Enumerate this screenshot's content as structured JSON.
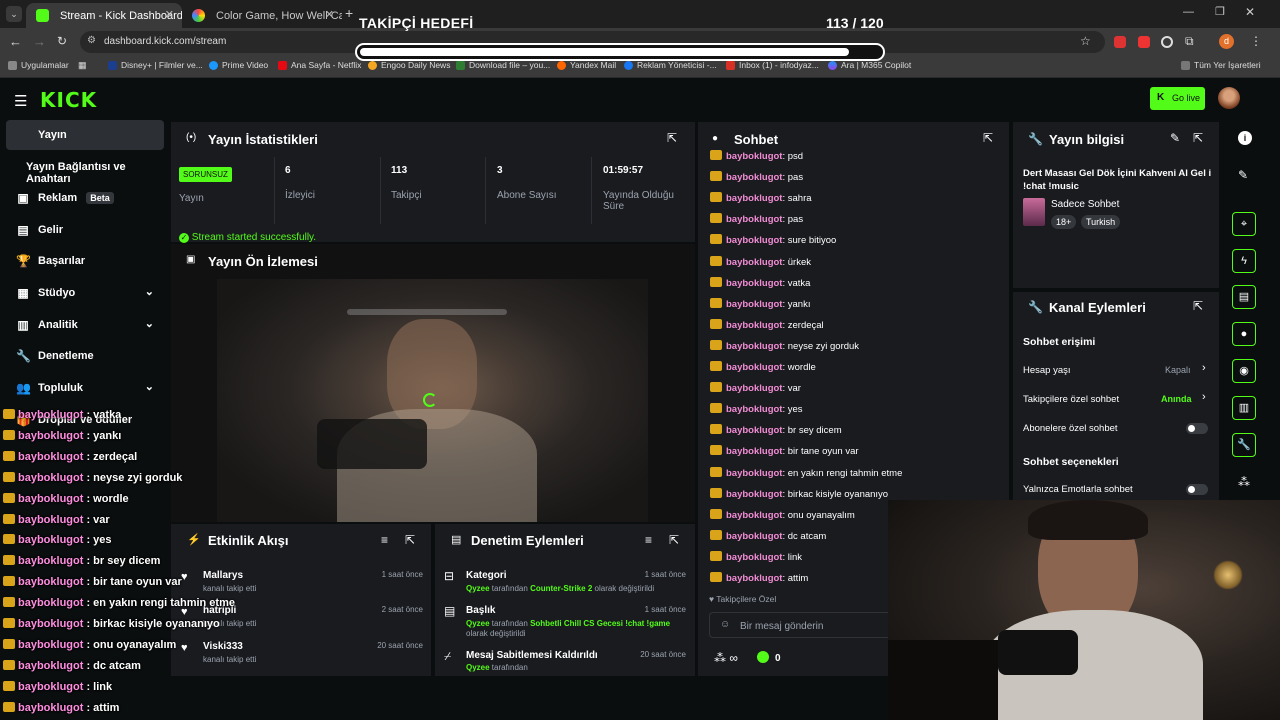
{
  "browser": {
    "tabs": [
      {
        "title": "Stream - Kick Dashboard",
        "active": true
      },
      {
        "title": "Color Game, How Well Can You",
        "active": false
      }
    ],
    "url": "dashboard.kick.com/stream",
    "bookmarks": [
      "Uygulamalar",
      "Disney+ | Filmler ve...",
      "Prime Video",
      "Ana Sayfa - Netflix",
      "Engoo Daily News",
      "Download file – you...",
      "Yandex Mail",
      "Reklam Yöneticisi -...",
      "Inbox (1) - infodyaz...",
      "Ara | M365 Copilot"
    ],
    "bookmarks_right": "Tüm Yer İşaretleri",
    "profile_initial": "d"
  },
  "overlay": {
    "goal_title": "TAKİPÇİ HEDEFİ",
    "goal_count": "113 / 120",
    "goal_progress": 0.94,
    "chat": [
      {
        "user": "bayboklugot",
        "msg": " : vatka"
      },
      {
        "user": "bayboklugot",
        "msg": " : yankı"
      },
      {
        "user": "bayboklugot",
        "msg": " : zerdeçal"
      },
      {
        "user": "bayboklugot",
        "msg": " : neyse zyi gorduk"
      },
      {
        "user": "bayboklugot",
        "msg": " : wordle"
      },
      {
        "user": "bayboklugot",
        "msg": " : var"
      },
      {
        "user": "bayboklugot",
        "msg": " : yes"
      },
      {
        "user": "bayboklugot",
        "msg": " : br sey dicem"
      },
      {
        "user": "bayboklugot",
        "msg": " : bir tane oyun var"
      },
      {
        "user": "bayboklugot",
        "msg": " : en yakın rengi tahmin etme"
      },
      {
        "user": "bayboklugot",
        "msg": " : birkac kisiyle oyananıyo"
      },
      {
        "user": "bayboklugot",
        "msg": " : onu oyanayalım"
      },
      {
        "user": "bayboklugot",
        "msg": " : dc atcam"
      },
      {
        "user": "bayboklugot",
        "msg": " : link"
      },
      {
        "user": "bayboklugot",
        "msg": " : attim"
      }
    ]
  },
  "kick": {
    "logo": "KICK",
    "go_live": "Go live",
    "nav": [
      {
        "label": "Yayın",
        "icon": "broadcast-icon",
        "active": true
      },
      {
        "label": "Yayın Bağlantısı ve Anahtarı",
        "icon": "",
        "active": false
      },
      {
        "label": "Reklam",
        "icon": "ad-icon",
        "badge": "Beta"
      },
      {
        "label": "Gelir",
        "icon": "chart-icon"
      },
      {
        "label": "Başarılar",
        "icon": "trophy-icon"
      },
      {
        "label": "Stüdyo",
        "icon": "studio-icon",
        "chevron": true
      },
      {
        "label": "Analitik",
        "icon": "analytics-icon",
        "chevron": true
      },
      {
        "label": "Denetleme",
        "icon": "wrench-icon"
      },
      {
        "label": "Topluluk",
        "icon": "community-icon",
        "chevron": true
      },
      {
        "label": "Droplar ve ödüller",
        "icon": "gift-icon"
      }
    ],
    "stats": {
      "title": "Yayın İstatistikleri",
      "status_badge": "SORUNSUZ",
      "status_label": "Yayın",
      "items": [
        {
          "value": "6",
          "label": "İzleyici"
        },
        {
          "value": "113",
          "label": "Takipçi"
        },
        {
          "value": "3",
          "label": "Abone Sayısı"
        },
        {
          "value": "01:59:57",
          "label": "Yayında Olduğu Süre"
        }
      ],
      "success": "Stream started successfully."
    },
    "preview": {
      "title": "Yayın Ön İzlemesi"
    },
    "activity": {
      "title": "Etkinlik Akışı",
      "items": [
        {
          "name": "Mallarys",
          "sub": "kanalı takip etti",
          "time": "1 saat önce"
        },
        {
          "name": "hatripli",
          "sub": "kanalı takip etti",
          "time": "2 saat önce"
        },
        {
          "name": "Viski333",
          "sub": "kanalı takip etti",
          "time": "20 saat önce"
        }
      ]
    },
    "moderation": {
      "title": "Denetim Eylemleri",
      "items": [
        {
          "title": "Kategori",
          "by": "Qyzee",
          "mid": " tarafından ",
          "hl": "Counter-Strike 2",
          "end": " olarak değiştirildi",
          "time": "1 saat önce"
        },
        {
          "title": "Başlık",
          "by": "Qyzee",
          "mid": " tarafından ",
          "hl": "Sohbetli Chill CS Gecesi !chat !game",
          "end": " olarak değiştirildi",
          "time": "1 saat önce"
        },
        {
          "title": "Mesaj Sabitlemesi Kaldırıldı",
          "by": "Qyzee",
          "mid": " tarafından",
          "hl": "",
          "end": "",
          "time": "20 saat önce"
        }
      ]
    },
    "chat": {
      "title": "Sohbet",
      "lines": [
        {
          "user": "bayboklugot",
          "msg": ": psd"
        },
        {
          "user": "bayboklugot",
          "msg": ": pas"
        },
        {
          "user": "bayboklugot",
          "msg": ": sahra"
        },
        {
          "user": "bayboklugot",
          "msg": ": pas"
        },
        {
          "user": "bayboklugot",
          "msg": ": sure bitiyoo"
        },
        {
          "user": "bayboklugot",
          "msg": ": ürkek"
        },
        {
          "user": "bayboklugot",
          "msg": ": vatka"
        },
        {
          "user": "bayboklugot",
          "msg": ": yankı"
        },
        {
          "user": "bayboklugot",
          "msg": ": zerdeçal"
        },
        {
          "user": "bayboklugot",
          "msg": ": neyse zyi gorduk"
        },
        {
          "user": "bayboklugot",
          "msg": ": wordle"
        },
        {
          "user": "bayboklugot",
          "msg": ": var"
        },
        {
          "user": "bayboklugot",
          "msg": ": yes"
        },
        {
          "user": "bayboklugot",
          "msg": ": br sey dicem"
        },
        {
          "user": "bayboklugot",
          "msg": ": bir tane oyun var"
        },
        {
          "user": "bayboklugot",
          "msg": ": en yakın rengi tahmin etme"
        },
        {
          "user": "bayboklugot",
          "msg": ": birkac kisiyle oyananıyo"
        },
        {
          "user": "bayboklugot",
          "msg": ": onu oyanayalım"
        },
        {
          "user": "bayboklugot",
          "msg": ": dc atcam"
        },
        {
          "user": "bayboklugot",
          "msg": ": link"
        },
        {
          "user": "bayboklugot",
          "msg": ": attim"
        }
      ],
      "followers_only": "Takipçilere Özel",
      "input_placeholder": "Bir mesaj gönderin",
      "kicks": "0",
      "infinity": "∞"
    },
    "stream_info": {
      "title": "Yayın bilgisi",
      "stream_title": "Dert Masası Gel Dök İçini Kahveni Al Gel i !chat !music",
      "category": "Sadece Sohbet",
      "tags": [
        "18+",
        "Turkish"
      ]
    },
    "channel_actions": {
      "title": "Kanal Eylemleri",
      "chat_access": "Sohbet erişimi",
      "rows": [
        {
          "label": "Hesap yaşı",
          "value": "Kapalı"
        },
        {
          "label": "Takipçilere özel sohbet",
          "value": "Anında"
        },
        {
          "label": "Abonelere özel sohbet",
          "value": ""
        }
      ],
      "chat_options": "Sohbet seçenekleri",
      "emote_only": "Yalnızca Emotlarla sohbet"
    }
  },
  "colors": {
    "kick_green": "#53fc18",
    "panel": "#191b1f",
    "username_pink": "#f28cd4"
  }
}
